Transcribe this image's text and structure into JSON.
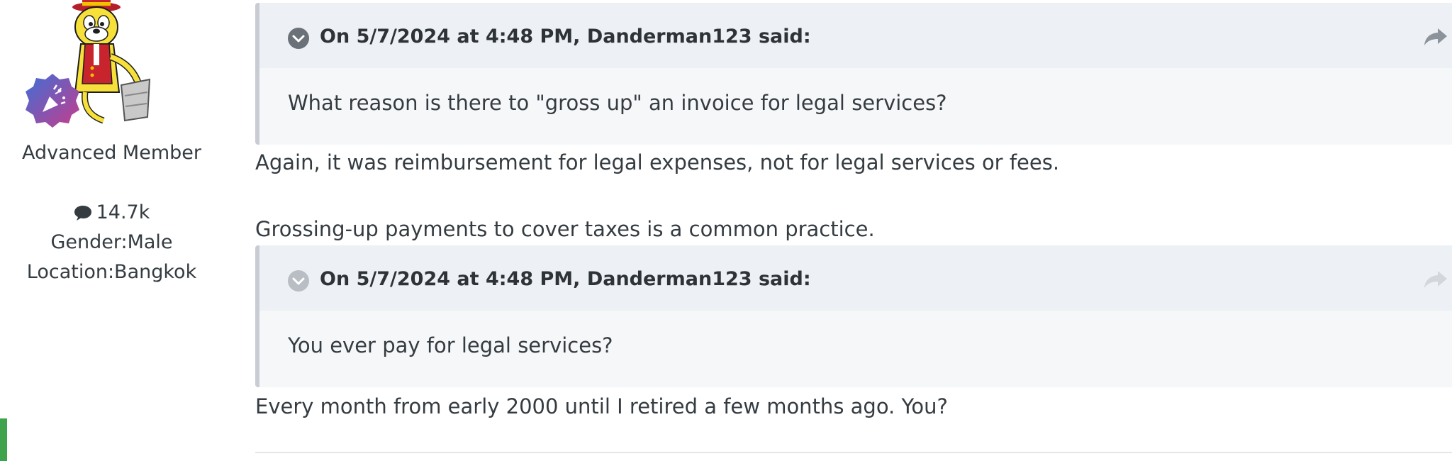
{
  "author": {
    "title": "Advanced Member",
    "posts_count": "14.7k",
    "gender": "Gender:Male",
    "location": "Location:Bangkok",
    "icons": [
      "avatar-cartoon-cat",
      "party-popper-badge-icon",
      "comment-bubble-icon"
    ]
  },
  "post": {
    "quotes": [
      {
        "citation": "On 5/7/2024 at 4:48 PM, Danderman123 said:",
        "text": "What reason is there to \"gross up\" an invoice for legal services?"
      },
      {
        "citation": "On 5/7/2024 at 4:48 PM, Danderman123 said:",
        "text": "You ever pay for legal services?"
      }
    ],
    "paragraphs": [
      "Again, it was reimbursement for legal expenses, not for legal services or fees.",
      "Grossing-up payments to cover taxes is a common practice.",
      "Every month from early 2000 until I retired a few months ago. You?"
    ]
  },
  "colors": {
    "quote_header_bg": "#edf0f4",
    "quote_body_bg": "#f6f7f9",
    "quote_border": "#c9cdd3",
    "text": "#353c41",
    "badge_gradient_start": "#3d6fd6",
    "badge_gradient_end": "#c83c8c"
  }
}
